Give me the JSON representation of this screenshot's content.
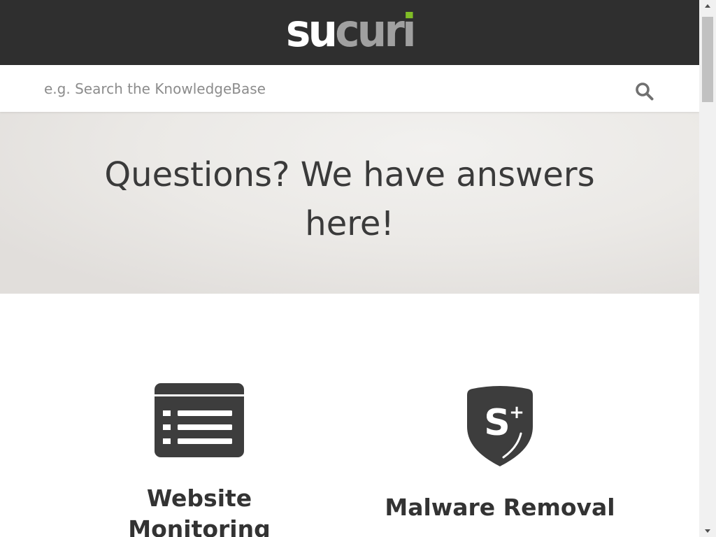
{
  "header": {
    "logo": {
      "name": "sucuri",
      "part_white": "su",
      "part_gray": "cur",
      "part_accent": "i"
    }
  },
  "search": {
    "placeholder": "e.g. Search the KnowledgeBase",
    "value": "",
    "button_icon": "search-icon"
  },
  "hero": {
    "title": "Questions? We have answers here!"
  },
  "categories": [
    {
      "title": "Website Monitoring",
      "icon": "monitoring-list-icon"
    },
    {
      "title": "Malware Removal",
      "icon": "shield-icon",
      "icon_letter": "S",
      "icon_plus": "+"
    }
  ],
  "scrollbar": {
    "up_icon": "arrow-up-icon",
    "down_icon": "arrow-down-icon"
  },
  "theme": {
    "header_bg": "#2f2f2f",
    "logo_white": "#ffffff",
    "logo_gray": "#a0a0a0",
    "logo_accent": "#80bd26",
    "text_color": "#333333",
    "icon_color": "#3d3d3d",
    "placeholder_color": "#8c8c8c"
  }
}
